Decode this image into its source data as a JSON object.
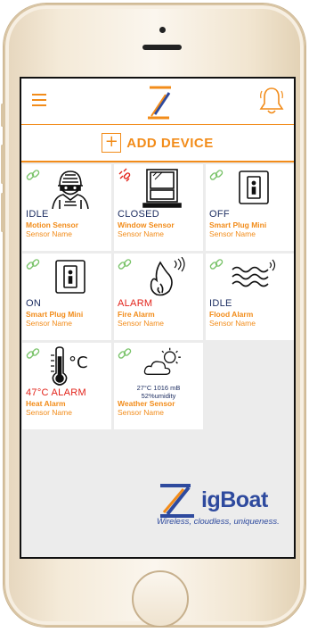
{
  "app": {
    "add_device_label": "ADD DEVICE",
    "brand_name": "igBoat",
    "brand_tagline": "Wireless, cloudless, uniqueness.",
    "accent_color": "#f28c1a",
    "navy_color": "#1a2b5f",
    "alarm_color": "#e2231a"
  },
  "devices": [
    {
      "status": "IDLE",
      "type": "Motion Sensor",
      "name": "Sensor Name",
      "icon": "burglar-icon",
      "link": "linked",
      "alarm": false
    },
    {
      "status": "CLOSED",
      "type": "Window Sensor",
      "name": "Sensor Name",
      "icon": "window-icon",
      "link": "broken",
      "alarm": false
    },
    {
      "status": "OFF",
      "type": "Smart Plug Mini",
      "name": "Sensor Name",
      "icon": "plug-icon",
      "link": "linked",
      "alarm": false
    },
    {
      "status": "ON",
      "type": "Smart Plug Mini",
      "name": "Sensor Name",
      "icon": "plug-icon",
      "link": "linked",
      "alarm": false
    },
    {
      "status": "ALARM",
      "type": "Fire Alarm",
      "name": "Sensor Name",
      "icon": "fire-icon",
      "link": "linked",
      "alarm": true
    },
    {
      "status": "IDLE",
      "type": "Flood Alarm",
      "name": "Sensor Name",
      "icon": "flood-icon",
      "link": "linked",
      "alarm": false
    },
    {
      "status": "47°C ALARM",
      "type": "Heat Alarm",
      "name": "Sensor Name",
      "icon": "thermometer-icon",
      "link": "linked",
      "alarm": true
    },
    {
      "status": "",
      "type": "Weather Sensor",
      "name": "Sensor Name",
      "icon": "weather-icon",
      "link": "linked",
      "alarm": false,
      "weather_line1": "27°C 1016 mB",
      "weather_line2": "52%umidity"
    }
  ]
}
